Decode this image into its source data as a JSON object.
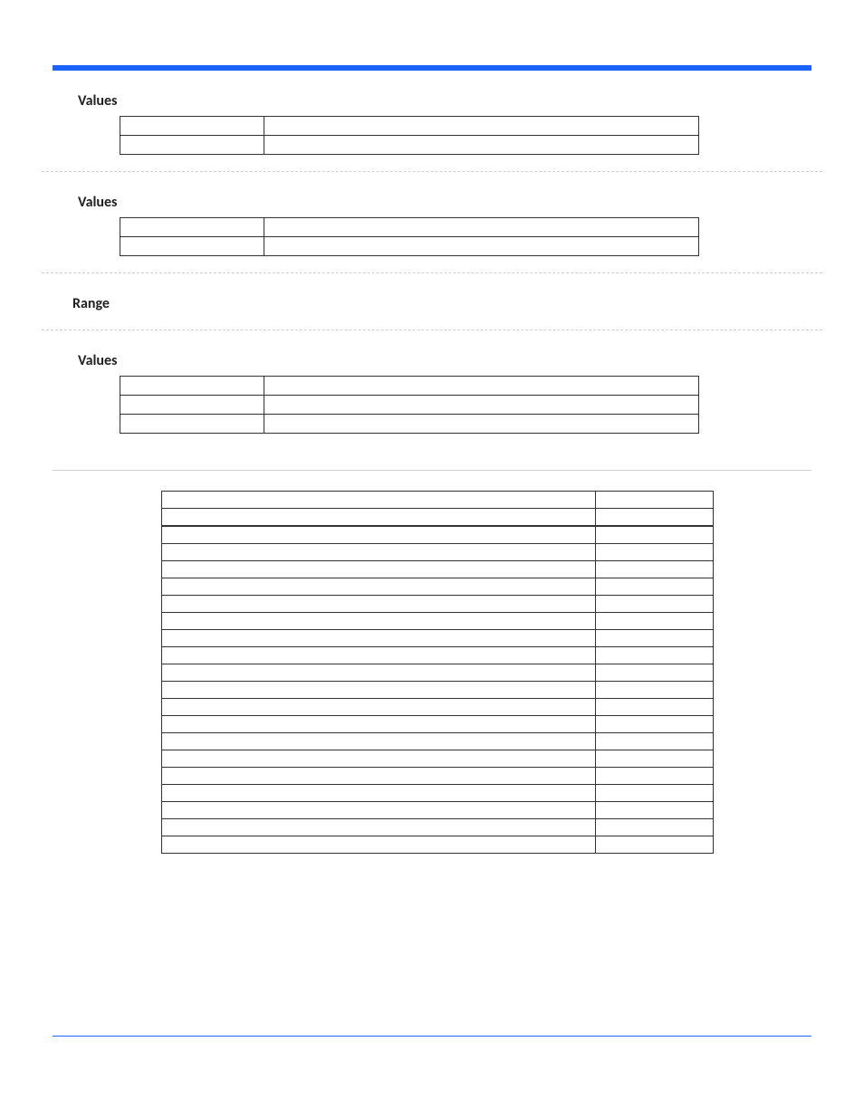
{
  "sections": {
    "group1": {
      "title": "Values",
      "rows": [
        [
          "",
          ""
        ],
        [
          "",
          ""
        ]
      ]
    },
    "group2": {
      "title": "Values",
      "rows": [
        [
          "",
          ""
        ],
        [
          "",
          ""
        ]
      ]
    },
    "range": {
      "title": "Range"
    },
    "group3": {
      "title": "Values",
      "rows": [
        [
          "",
          ""
        ],
        [
          "",
          ""
        ],
        [
          "",
          ""
        ]
      ]
    }
  },
  "summary": {
    "rows": [
      [
        "",
        ""
      ],
      [
        "",
        ""
      ],
      [
        "",
        ""
      ],
      [
        "",
        ""
      ],
      [
        "",
        ""
      ],
      [
        "",
        ""
      ],
      [
        "",
        ""
      ],
      [
        "",
        ""
      ],
      [
        "",
        ""
      ],
      [
        "",
        ""
      ],
      [
        "",
        ""
      ],
      [
        "",
        ""
      ],
      [
        "",
        ""
      ],
      [
        "",
        ""
      ],
      [
        "",
        ""
      ],
      [
        "",
        ""
      ],
      [
        "",
        ""
      ],
      [
        "",
        ""
      ],
      [
        "",
        ""
      ],
      [
        "",
        ""
      ],
      [
        "",
        ""
      ]
    ]
  }
}
